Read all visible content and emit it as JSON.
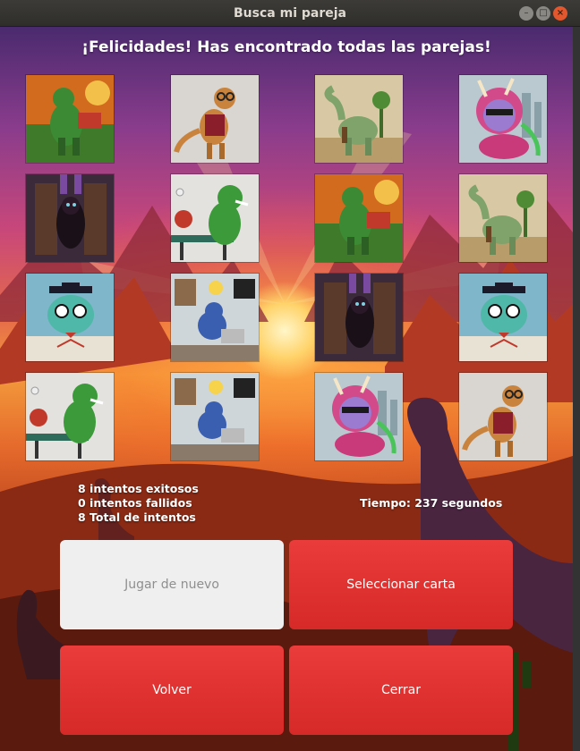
{
  "window": {
    "title": "Busca mi pareja",
    "controls": [
      "minimize-icon",
      "maximize-icon",
      "close-icon"
    ]
  },
  "game": {
    "headline": "¡Felicidades! Has encontrado todas las parejas!",
    "board": [
      [
        "dino-reading",
        "dino-scientist",
        "dino-bottle",
        "triceratops-sunglasses"
      ],
      [
        "dark-dino",
        "dino-pingpong",
        "dino-reading",
        "dino-bottle"
      ],
      [
        "dino-graduate",
        "dino-programmer",
        "dark-dino",
        "dino-graduate"
      ],
      [
        "dino-pingpong",
        "dino-programmer",
        "triceratops-sunglasses",
        "dino-scientist"
      ]
    ],
    "stats": {
      "successful": "8 intentos exitosos",
      "failed": "0 intentos fallidos",
      "total": "8 Total de intentos"
    },
    "timer": "Tiempo: 237 segundos"
  },
  "buttons": {
    "play_again": "Jugar de nuevo",
    "select_card": "Seleccionar carta",
    "back": "Volver",
    "close": "Cerrar"
  },
  "colors": {
    "button_red": "#e2332f",
    "button_disabled": "#efefef",
    "titlebar": "#3c3b37",
    "close_button": "#e2572d"
  }
}
